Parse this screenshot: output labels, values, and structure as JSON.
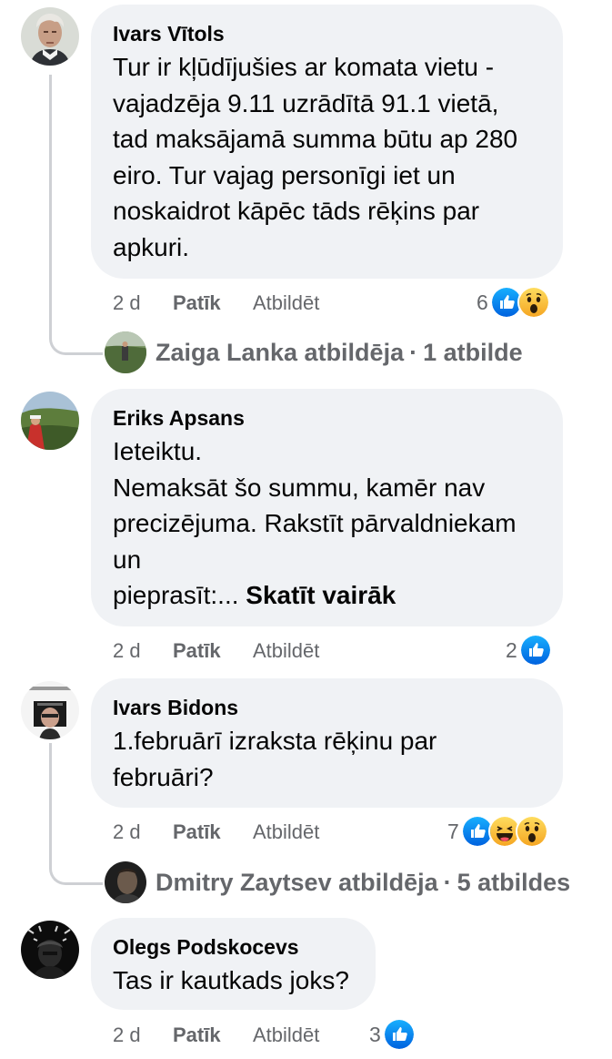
{
  "comments": [
    {
      "author": "Ivars Vītols",
      "lines": [
        "Tur ir kļūdījušies ar komata vietu -",
        "vajadzēja 9.11 uzrādītā 91.1 vietā,",
        "tad maksājamā summa būtu ap 280",
        "eiro. Tur vajag personīgi iet un",
        "noskaidrot kāpēc tāds rēķins par",
        "apkuri."
      ],
      "time": "2 d",
      "like_label": "Patīk",
      "reply_label": "Atbildēt",
      "reaction_count": "6",
      "reactions": [
        "like-icon",
        "wow-icon"
      ],
      "reply_summary": {
        "author_action": "Zaiga Lanka atbildēja",
        "separator": "·",
        "count_text": "1 atbilde"
      }
    },
    {
      "author": "Eriks Apsans",
      "lines": [
        "Ieteiktu.",
        "Nemaksāt šo summu, kamēr nav",
        "precizējuma. Rakstīt pārvaldniekam",
        "un",
        "pieprasīt:..."
      ],
      "see_more": "Skatīt vairāk",
      "time": "2 d",
      "like_label": "Patīk",
      "reply_label": "Atbildēt",
      "reaction_count": "2",
      "reactions": [
        "like-icon"
      ]
    },
    {
      "author": "Ivars Bidons",
      "lines": [
        "1.februārī izraksta rēķinu par",
        "februāri?"
      ],
      "time": "2 d",
      "like_label": "Patīk",
      "reply_label": "Atbildēt",
      "reaction_count": "7",
      "reactions": [
        "like-icon",
        "haha-icon",
        "wow-icon"
      ],
      "reply_summary": {
        "author_action": "Dmitry Zaytsev atbildēja",
        "separator": "·",
        "count_text": "5 atbildes"
      }
    },
    {
      "author": "Olegs Podskocevs",
      "lines": [
        "Tas ir kautkads joks?"
      ],
      "time": "2 d",
      "like_label": "Patīk",
      "reply_label": "Atbildēt",
      "reaction_count": "3",
      "reactions": [
        "like-icon"
      ]
    }
  ],
  "colors": {
    "bubble": "#f0f2f5",
    "meta_text": "#65676b",
    "like_blue": "#1877f2",
    "wow_yellow": "#f7b125"
  }
}
